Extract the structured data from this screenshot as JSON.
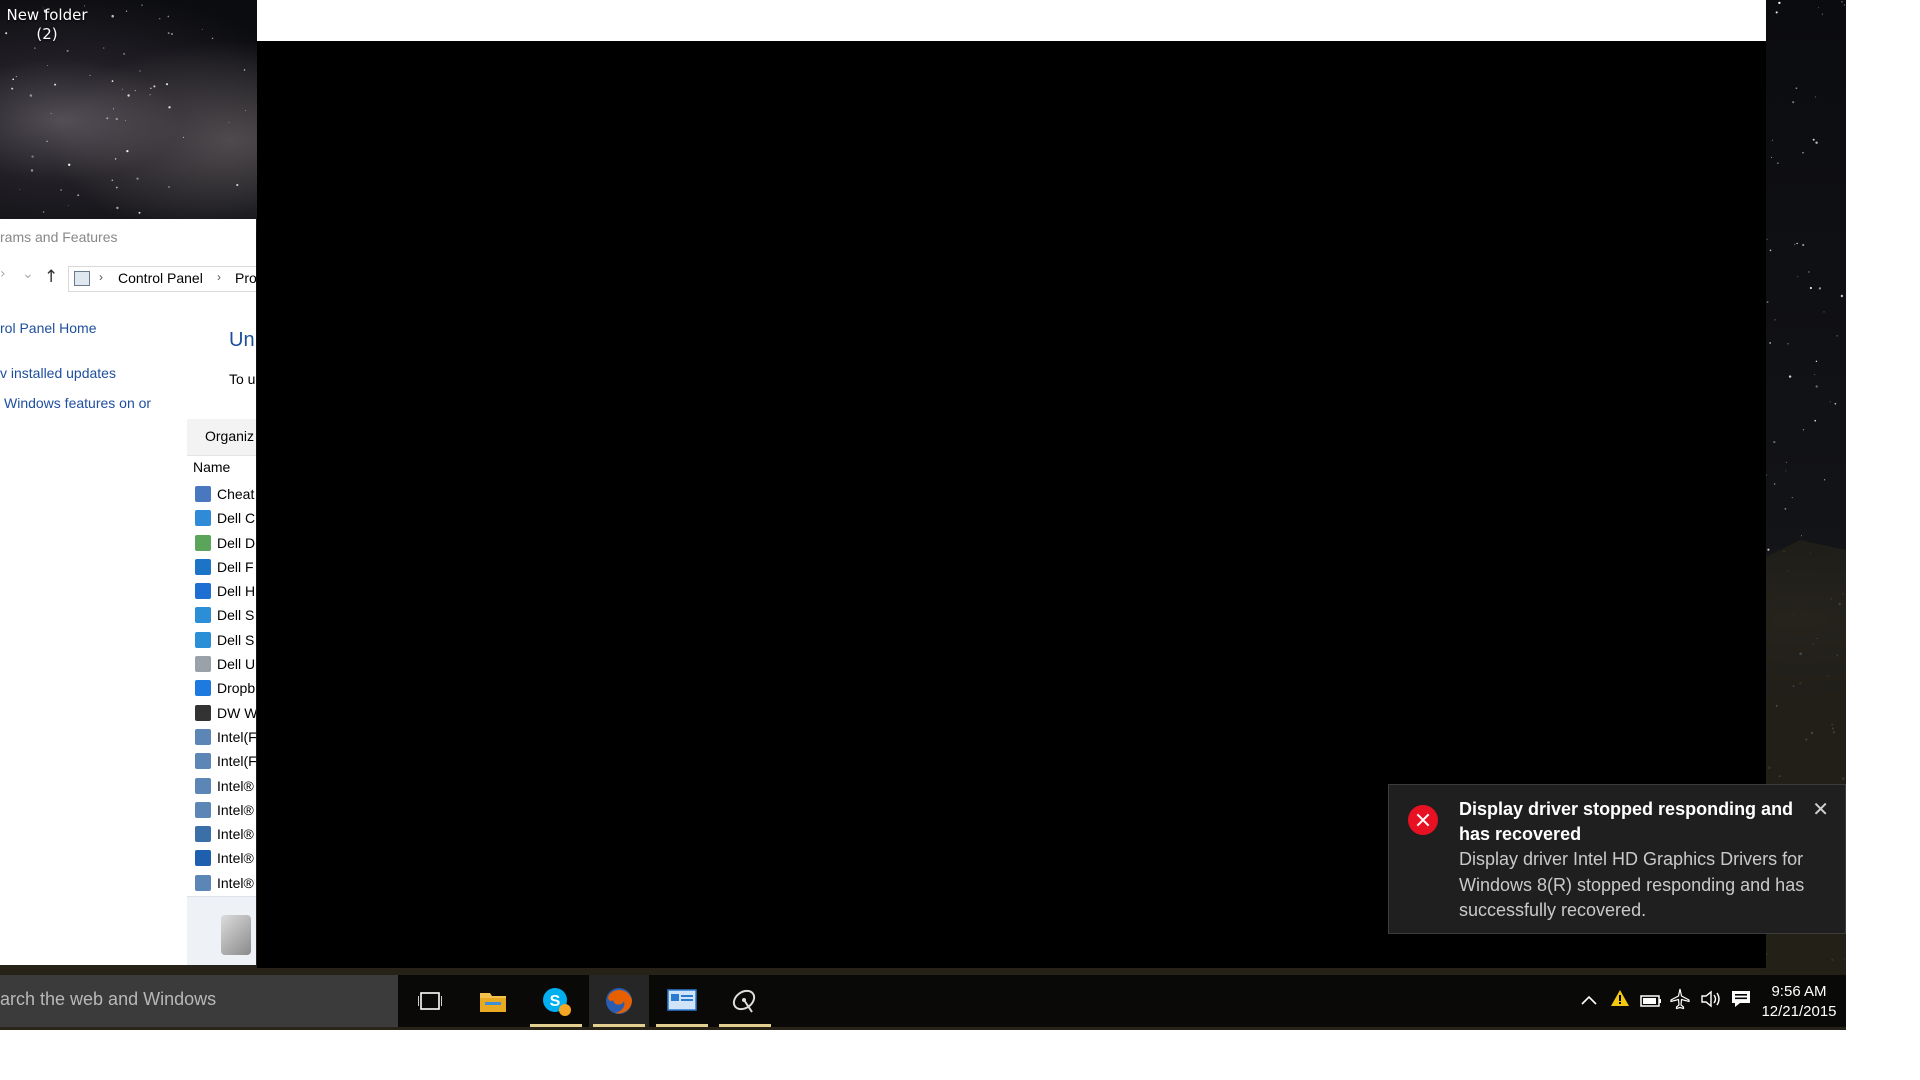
{
  "desktop": {
    "icon": {
      "label_line1": "New folder",
      "label_line2": "(2)"
    }
  },
  "control_panel": {
    "title": "rams and Features",
    "breadcrumb": [
      "Control Panel",
      "Pro"
    ],
    "links": [
      "rol Panel Home",
      "v installed updates",
      "Windows features on or"
    ],
    "heading": "Un",
    "instruction": "To u",
    "toolbar_label": "Organiz",
    "column_header": "Name",
    "programs": [
      {
        "name": "Cheat",
        "icon": "app-window-icon",
        "color": "#4a78c0"
      },
      {
        "name": "Dell C",
        "icon": "dell-command-icon",
        "color": "#2f8ad8"
      },
      {
        "name": "Dell D",
        "icon": "globe-icon",
        "color": "#5aa55a"
      },
      {
        "name": "Dell F",
        "icon": "dell-logo-icon",
        "color": "#1b74c6"
      },
      {
        "name": "Dell H",
        "icon": "gear-icon",
        "color": "#1d6fd1"
      },
      {
        "name": "Dell S",
        "icon": "support-icon",
        "color": "#2c8ed6"
      },
      {
        "name": "Dell S",
        "icon": "support-icon",
        "color": "#2c8ed6"
      },
      {
        "name": "Dell U",
        "icon": "update-icon",
        "color": "#9aa1a8"
      },
      {
        "name": "Dropb",
        "icon": "dropbox-icon",
        "color": "#1f7ae0"
      },
      {
        "name": "DW W",
        "icon": "wireless-icon",
        "color": "#333333"
      },
      {
        "name": "Intel(F",
        "icon": "installer-icon",
        "color": "#5b86b5"
      },
      {
        "name": "Intel(F",
        "icon": "installer-icon",
        "color": "#5b86b5"
      },
      {
        "name": "Intel®",
        "icon": "installer-icon",
        "color": "#5b86b5"
      },
      {
        "name": "Intel®",
        "icon": "installer-icon",
        "color": "#5b86b5"
      },
      {
        "name": "Intel®",
        "icon": "intel-globe-icon",
        "color": "#3a6fa8"
      },
      {
        "name": "Intel®",
        "icon": "upload-icon",
        "color": "#1f5fb0"
      },
      {
        "name": "Intel®",
        "icon": "installer-icon",
        "color": "#5b86b5"
      }
    ]
  },
  "toast": {
    "title": "Display driver stopped responding and has recovered",
    "body": "Display driver Intel HD Graphics Drivers for Windows 8(R) stopped responding and has successfully recovered.",
    "close": "✕",
    "icon": "error-icon",
    "icon_color": "#e81123"
  },
  "taskbar": {
    "search_placeholder": "arch the web and Windows",
    "apps": [
      {
        "name": "task-view-icon",
        "active": false,
        "running": false
      },
      {
        "name": "file-explorer-icon",
        "active": false,
        "running": false
      },
      {
        "name": "skype-icon",
        "active": false,
        "running": true
      },
      {
        "name": "firefox-icon",
        "active": true,
        "running": true
      },
      {
        "name": "control-panel-icon",
        "active": false,
        "running": true
      },
      {
        "name": "satellite-dish-icon",
        "active": false,
        "running": true
      }
    ],
    "tray": [
      "chevron-up-icon",
      "warning-icon",
      "battery-icon",
      "airplane-icon",
      "volume-icon",
      "action-center-icon"
    ],
    "clock": {
      "time": "9:56 AM",
      "date": "12/21/2015"
    }
  },
  "colors": {
    "link": "#1e4e9e",
    "taskbar_accent": "#e3d090",
    "toast_bg": "#1f1f1f"
  }
}
